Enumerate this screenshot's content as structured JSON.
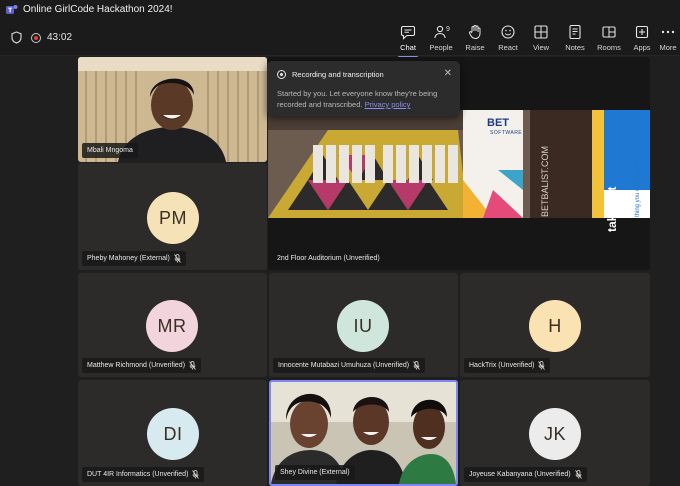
{
  "window": {
    "title": "Online GirlCode Hackathon 2024!"
  },
  "meeting": {
    "timer": "43:02"
  },
  "toolbar": {
    "chat": "Chat",
    "people": "People",
    "people_count": "9",
    "raise": "Raise",
    "react": "React",
    "view": "View",
    "notes": "Notes",
    "rooms": "Rooms",
    "apps": "Apps",
    "more": "More"
  },
  "popup": {
    "title": "Recording and transcription",
    "body": "Started by you. Let everyone know they're being recorded and transcribed.",
    "link": "Privacy policy"
  },
  "participants": [
    {
      "name": "Mbali Mngoma",
      "type": "video"
    },
    {
      "name": "Pheby Mahoney (External)",
      "initials": "PM",
      "avatar_color": "#f6e2b7",
      "muted": true
    },
    {
      "name": "2nd Floor Auditorium (Unverified)",
      "type": "video"
    },
    {
      "name": "Matthew Richmond (Unverified)",
      "initials": "MR",
      "avatar_color": "#f2d5dc",
      "muted": true
    },
    {
      "name": "Innocente Mutabazi Umuhuza (Unverified)",
      "initials": "IU",
      "avatar_color": "#cfe6dd",
      "muted": true
    },
    {
      "name": "HackTrix (Unverified)",
      "initials": "H",
      "avatar_color": "#fbe2b2",
      "muted": true
    },
    {
      "name": "DUT 4IR Informatics (Unverified)",
      "initials": "DI",
      "avatar_color": "#d7eaf0",
      "muted": true
    },
    {
      "name": "Shey Divine (External)",
      "type": "video"
    },
    {
      "name": "Joyeuse Kabanyana (Unverified)",
      "initials": "JK",
      "avatar_color": "#ececec",
      "muted": true
    }
  ],
  "auditorium_signs": {
    "sponsor1": "BET",
    "sponsor1_sub": "SOFTWARE",
    "sponsor2": "BETBALIST.COM",
    "sponsor3": "takealot",
    "sponsor3_sub": "thing you can imagine"
  },
  "colors": {
    "accent": "#8c8fe8",
    "record": "#e0403b",
    "speaking_border": "#7f85f5"
  }
}
